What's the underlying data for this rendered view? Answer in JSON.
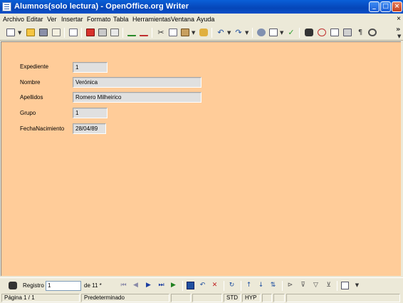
{
  "window": {
    "title": "Alumnos(solo lectura) - OpenOffice.org Writer",
    "minimize_symbol": "_",
    "maximize_symbol": "□",
    "close_symbol": "×"
  },
  "menu": {
    "items": [
      "Archivo",
      "Editar",
      "Ver",
      "Insertar",
      "Formato",
      "Tabla",
      "Herramientas",
      "Ventana",
      "Ayuda"
    ],
    "close_symbol": "×"
  },
  "toolbar": {
    "icons": [
      "new-document-icon",
      "open-folder-icon",
      "save-icon",
      "email-icon",
      "edit-file-icon",
      "export-pdf-icon",
      "print-icon",
      "page-preview-icon",
      "spellcheck-icon",
      "autospellcheck-icon",
      "cut-icon",
      "copy-icon",
      "paste-icon",
      "format-paintbrush-icon",
      "undo-icon",
      "redo-icon",
      "hyperlink-icon",
      "table-icon",
      "draw-functions-icon",
      "find-replace-icon",
      "navigator-icon",
      "gallery-icon",
      "data-sources-icon",
      "nonprinting-characters-icon",
      "zoom-icon"
    ],
    "overflow_symbol": "»"
  },
  "form": {
    "fields": [
      {
        "label": "Expediente",
        "value": "1"
      },
      {
        "label": "Nombre",
        "value": "Verónica"
      },
      {
        "label": "Apellidos",
        "value": "Romero Milheirico"
      },
      {
        "label": "Grupo",
        "value": "1"
      },
      {
        "label": "FechaNacimiento",
        "value": "28/04/89"
      }
    ],
    "background": "#ffcc99"
  },
  "navigation": {
    "record_label": "Registro",
    "record_value": "1",
    "count_text": "de 11 *",
    "icons": [
      "first-record-icon",
      "previous-record-icon",
      "next-record-icon",
      "last-record-icon",
      "new-record-icon",
      "save-record-icon",
      "undo-record-icon",
      "delete-record-icon",
      "refresh-icon",
      "sort-ascending-icon",
      "sort-descending-icon",
      "sort-icon",
      "autofilter-icon",
      "standard-filter-icon",
      "remove-filter-icon",
      "data-to-text-icon"
    ]
  },
  "status": {
    "page": "Página  1 / 1",
    "style": "Predeterminado",
    "mode_std": "STD",
    "mode_hyp": "HYP"
  },
  "colors": {
    "titlebar": "#0a5fd8",
    "chrome": "#ece9d8",
    "document": "#ffcc99"
  }
}
